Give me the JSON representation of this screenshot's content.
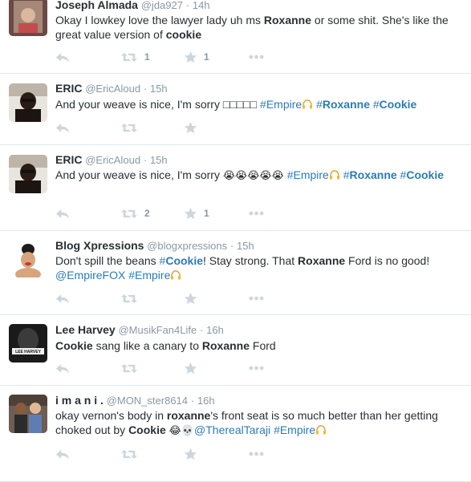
{
  "icons": {
    "reply": "reply-icon",
    "retweet": "retweet-icon",
    "favorite": "star-icon",
    "more": "more-icon",
    "headphone": "headphone-icon"
  },
  "colors": {
    "link": "#2b7bb9",
    "muted": "#8899a6",
    "action_icon": "#ccd6dd",
    "divider": "#e1e8ed"
  },
  "tweets": [
    {
      "fullname": "Joseph Almada",
      "username": "@jda927",
      "sep": "·",
      "time": "14h",
      "t1": "Okay I lowkey love the lawyer lady uh ms ",
      "t2": "Roxanne",
      "t3": " or some shit. She's like the great value version of ",
      "t4": "cookie",
      "retweets": "1",
      "favorites": "1"
    },
    {
      "fullname": "ERIC",
      "username": "@EricAloud",
      "sep": "·",
      "time": "15h",
      "t1": "And your weave is nice, I'm sorry □□□□□ ",
      "tag1": "#Empire",
      "tag2_hash": "#",
      "tag2_word": "Roxanne",
      "tag3_hash": "#",
      "tag3_word": "Cookie",
      "retweets": "",
      "favorites": ""
    },
    {
      "fullname": "ERIC",
      "username": "@EricAloud",
      "sep": "·",
      "time": "15h",
      "t1": "And your weave is nice, I'm sorry ",
      "emojis": "😭😭😭😭😭",
      "tag1": "#Empire",
      "tag2_hash": "#",
      "tag2_word": "Roxanne",
      "tag3_hash": "#",
      "tag3_word": "Cookie",
      "retweets": "2",
      "favorites": "1"
    },
    {
      "fullname": "Blog Xpressions",
      "username": "@blogxpressions",
      "sep": "·",
      "time": "15h",
      "t1": "Don't spill the beans ",
      "tag1_hash": "#",
      "tag1_word": "Cookie",
      "t2": "! Stay strong. That ",
      "t3": "Roxanne",
      "t4": " Ford is no good!",
      "mention": "@EmpireFOX",
      "tag2": "#Empire",
      "retweets": "",
      "favorites": ""
    },
    {
      "fullname": "Lee Harvey",
      "username": "@MusikFan4Life",
      "sep": "·",
      "time": "16h",
      "t1": "Cookie",
      "t2": " sang like a canary to ",
      "t3": "Roxanne",
      "t4": " Ford",
      "avatar_text": "LEE HARVEY",
      "retweets": "",
      "favorites": ""
    },
    {
      "fullname": "i m a n i .",
      "username": "@MON_ster8614",
      "sep": "·",
      "time": "16h",
      "t1": "okay vernon's body in ",
      "t2": "roxanne",
      "t3": "'s front seat is so much better than her getting choked out by ",
      "t4": "Cookie",
      "emojis": "😂💀",
      "mention": "@TherealTaraji",
      "tag1": "#Empire",
      "retweets": "",
      "favorites": ""
    }
  ]
}
